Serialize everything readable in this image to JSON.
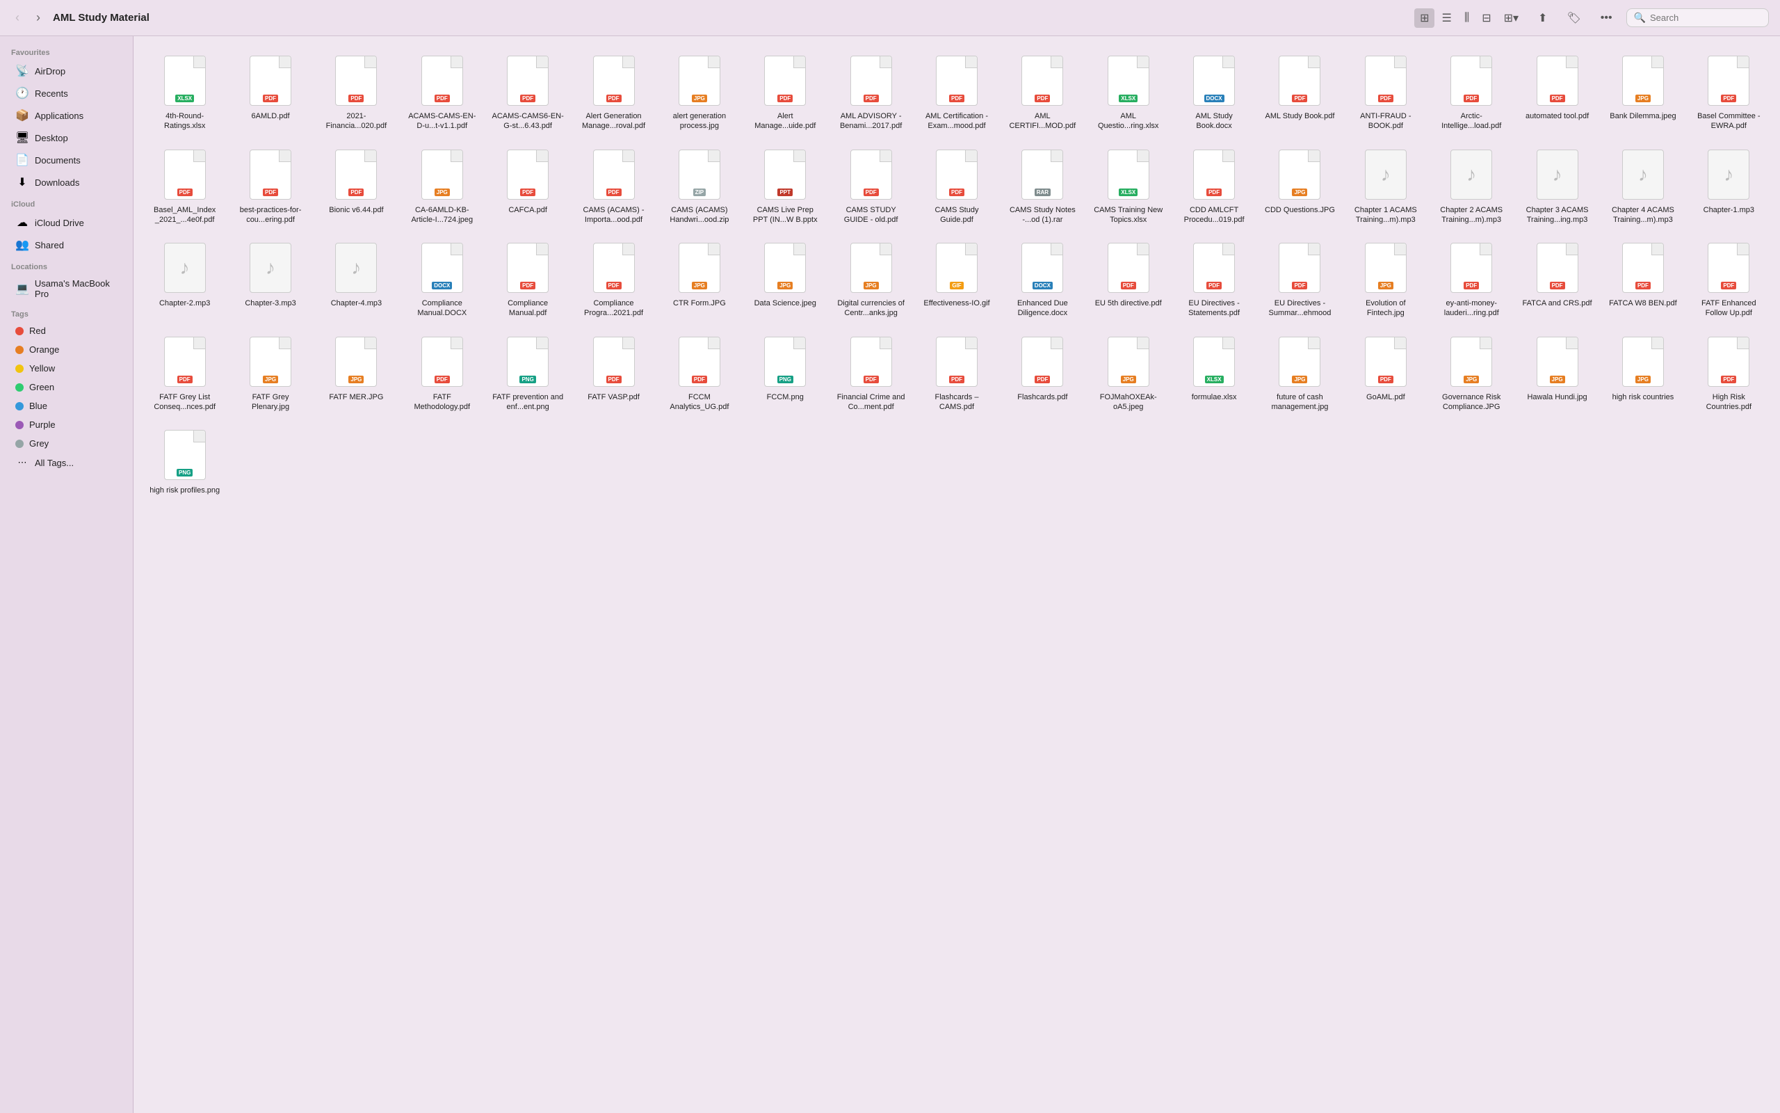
{
  "toolbar": {
    "title": "AML Study Material",
    "search_placeholder": "Search",
    "back_label": "‹",
    "forward_label": "›"
  },
  "sidebar": {
    "favourites_label": "Favourites",
    "icloud_label": "iCloud",
    "locations_label": "Locations",
    "tags_label": "Tags",
    "favourites": [
      {
        "id": "airdrop",
        "label": "AirDrop",
        "icon": "📡"
      },
      {
        "id": "recents",
        "label": "Recents",
        "icon": "🕐"
      },
      {
        "id": "applications",
        "label": "Applications",
        "icon": "📦"
      },
      {
        "id": "desktop",
        "label": "Desktop",
        "icon": "🖥"
      },
      {
        "id": "documents",
        "label": "Documents",
        "icon": "📄"
      },
      {
        "id": "downloads",
        "label": "Downloads",
        "icon": "⬇"
      }
    ],
    "icloud": [
      {
        "id": "icloud-drive",
        "label": "iCloud Drive",
        "icon": "☁"
      },
      {
        "id": "shared",
        "label": "Shared",
        "icon": "👥"
      }
    ],
    "locations": [
      {
        "id": "macbook",
        "label": "Usama's MacBook Pro",
        "icon": "💻"
      }
    ],
    "tags": [
      {
        "id": "red",
        "label": "Red",
        "color": "#e74c3c"
      },
      {
        "id": "orange",
        "label": "Orange",
        "color": "#e67e22"
      },
      {
        "id": "yellow",
        "label": "Yellow",
        "color": "#f1c40f"
      },
      {
        "id": "green",
        "label": "Green",
        "color": "#2ecc71"
      },
      {
        "id": "blue",
        "label": "Blue",
        "color": "#3498db"
      },
      {
        "id": "purple",
        "label": "Purple",
        "color": "#9b59b6"
      },
      {
        "id": "grey",
        "label": "Grey",
        "color": "#95a5a6"
      },
      {
        "id": "all-tags",
        "label": "All Tags...",
        "color": null
      }
    ]
  },
  "files": [
    {
      "name": "4th-Round-Ratings.xlsx",
      "type": "xlsx"
    },
    {
      "name": "6AMLD.pdf",
      "type": "pdf"
    },
    {
      "name": "2021-Financia...020.pdf",
      "type": "pdf"
    },
    {
      "name": "ACAMS-CAMS-EN-D-u...t-v1.1.pdf",
      "type": "pdf"
    },
    {
      "name": "ACAMS-CAMS6-EN-G-st...6.43.pdf",
      "type": "pdf"
    },
    {
      "name": "Alert Generation Manage...roval.pdf",
      "type": "pdf"
    },
    {
      "name": "alert generation process.jpg",
      "type": "jpg"
    },
    {
      "name": "Alert Manage...uide.pdf",
      "type": "pdf"
    },
    {
      "name": "AML ADVISORY - Benami...2017.pdf",
      "type": "pdf"
    },
    {
      "name": "AML Certification - Exam...mood.pdf",
      "type": "pdf"
    },
    {
      "name": "AML CERTIFI...MOD.pdf",
      "type": "pdf"
    },
    {
      "name": "AML Questio...ring.xlsx",
      "type": "xlsx"
    },
    {
      "name": "AML Study Book.docx",
      "type": "docx"
    },
    {
      "name": "AML Study Book.pdf",
      "type": "pdf"
    },
    {
      "name": "ANTI-FRAUD - BOOK.pdf",
      "type": "pdf"
    },
    {
      "name": "Arctic-Intellige...load.pdf",
      "type": "pdf"
    },
    {
      "name": "automated tool.pdf",
      "type": "pdf"
    },
    {
      "name": "Bank Dilemma.jpeg",
      "type": "jpg"
    },
    {
      "name": "Basel Committee - EWRA.pdf",
      "type": "pdf"
    },
    {
      "name": "Basel_AML_Index _2021_...4e0f.pdf",
      "type": "pdf"
    },
    {
      "name": "best-practices-for-cou...ering.pdf",
      "type": "pdf"
    },
    {
      "name": "Bionic v6.44.pdf",
      "type": "pdf"
    },
    {
      "name": "CA-6AMLD-KB-Article-I...724.jpeg",
      "type": "jpg"
    },
    {
      "name": "CAFCA.pdf",
      "type": "pdf"
    },
    {
      "name": "CAMS (ACAMS) - Importa...ood.pdf",
      "type": "pdf"
    },
    {
      "name": "CAMS (ACAMS) Handwri...ood.zip",
      "type": "zip"
    },
    {
      "name": "CAMS Live Prep PPT (IN...W B.pptx",
      "type": "pptx"
    },
    {
      "name": "CAMS STUDY GUIDE - old.pdf",
      "type": "pdf"
    },
    {
      "name": "CAMS Study Guide.pdf",
      "type": "pdf"
    },
    {
      "name": "CAMS Study Notes -...od (1).rar",
      "type": "rar"
    },
    {
      "name": "CAMS Training New Topics.xlsx",
      "type": "xlsx"
    },
    {
      "name": "CDD AMLCFT Procedu...019.pdf",
      "type": "pdf"
    },
    {
      "name": "CDD Questions.JPG",
      "type": "jpg"
    },
    {
      "name": "Chapter 1 ACAMS Training...m).mp3",
      "type": "mp3"
    },
    {
      "name": "Chapter 2 ACAMS Training...m).mp3",
      "type": "mp3"
    },
    {
      "name": "Chapter 3 ACAMS Training...ing.mp3",
      "type": "mp3"
    },
    {
      "name": "Chapter 4 ACAMS Training...m).mp3",
      "type": "mp3"
    },
    {
      "name": "Chapter-1.mp3",
      "type": "mp3"
    },
    {
      "name": "Chapter-2.mp3",
      "type": "mp3"
    },
    {
      "name": "Chapter-3.mp3",
      "type": "mp3"
    },
    {
      "name": "Chapter-4.mp3",
      "type": "mp3"
    },
    {
      "name": "Compliance Manual.DOCX",
      "type": "docx"
    },
    {
      "name": "Compliance Manual.pdf",
      "type": "pdf"
    },
    {
      "name": "Compliance Progra...2021.pdf",
      "type": "pdf"
    },
    {
      "name": "CTR Form.JPG",
      "type": "jpg"
    },
    {
      "name": "Data Science.jpeg",
      "type": "jpg"
    },
    {
      "name": "Digital currencies of Centr...anks.jpg",
      "type": "jpg"
    },
    {
      "name": "Effectiveness-IO.gif",
      "type": "gif"
    },
    {
      "name": "Enhanced Due Diligence.docx",
      "type": "docx"
    },
    {
      "name": "EU 5th directive.pdf",
      "type": "pdf"
    },
    {
      "name": "EU Directives - Statements.pdf",
      "type": "pdf"
    },
    {
      "name": "EU Directives - Summar...ehmood",
      "type": "pdf"
    },
    {
      "name": "Evolution of Fintech.jpg",
      "type": "jpg"
    },
    {
      "name": "ey-anti-money-lauderi...ring.pdf",
      "type": "pdf"
    },
    {
      "name": "FATCA and CRS.pdf",
      "type": "pdf"
    },
    {
      "name": "FATCA W8 BEN.pdf",
      "type": "pdf"
    },
    {
      "name": "FATF Enhanced Follow Up.pdf",
      "type": "pdf"
    },
    {
      "name": "FATF Grey List Conseq...nces.pdf",
      "type": "pdf"
    },
    {
      "name": "FATF Grey Plenary.jpg",
      "type": "jpg"
    },
    {
      "name": "FATF MER.JPG",
      "type": "jpg"
    },
    {
      "name": "FATF Methodology.pdf",
      "type": "pdf"
    },
    {
      "name": "FATF prevention and enf...ent.png",
      "type": "png"
    },
    {
      "name": "FATF VASP.pdf",
      "type": "pdf"
    },
    {
      "name": "FCCM Analytics_UG.pdf",
      "type": "pdf"
    },
    {
      "name": "FCCM.png",
      "type": "png"
    },
    {
      "name": "Financial Crime and Co...ment.pdf",
      "type": "pdf"
    },
    {
      "name": "Flashcards – CAMS.pdf",
      "type": "pdf"
    },
    {
      "name": "Flashcards.pdf",
      "type": "pdf"
    },
    {
      "name": "FOJMahOXEAk-oA5.jpeg",
      "type": "jpg"
    },
    {
      "name": "formulae.xlsx",
      "type": "xlsx"
    },
    {
      "name": "future of cash management.jpg",
      "type": "jpg"
    },
    {
      "name": "GoAML.pdf",
      "type": "pdf"
    },
    {
      "name": "Governance Risk Compliance.JPG",
      "type": "jpg"
    },
    {
      "name": "Hawala Hundi.jpg",
      "type": "jpg"
    },
    {
      "name": "high risk countries",
      "type": "jpg"
    },
    {
      "name": "High Risk Countries.pdf",
      "type": "pdf"
    },
    {
      "name": "high risk profiles.png",
      "type": "png"
    }
  ]
}
